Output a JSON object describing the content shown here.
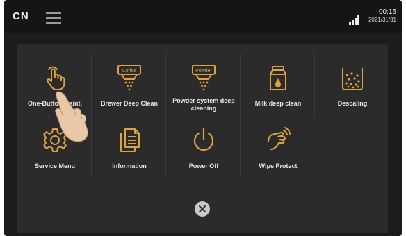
{
  "statusbar": {
    "lang": "CN",
    "time": "00:15",
    "date": "2021/31/31"
  },
  "tiles": [
    {
      "label": "One-Button Maint.",
      "icon": "hand-tap-icon"
    },
    {
      "label": "Brewer Deep Clean",
      "icon": "coffee-unit-icon",
      "icon_text": "Coffee"
    },
    {
      "label": "Powder system deep",
      "label2": "cleaning",
      "icon": "powder-unit-icon",
      "icon_text": "Powder"
    },
    {
      "label": "Milk deep clean",
      "icon": "milk-carton-icon"
    },
    {
      "label": "Descaling",
      "icon": "descaling-cup-icon"
    },
    {
      "label": "Service Menu",
      "icon": "gear-icon"
    },
    {
      "label": "Information",
      "icon": "documents-icon"
    },
    {
      "label": "Power Off",
      "icon": "power-icon"
    },
    {
      "label": "Wipe Protect",
      "icon": "wipe-hand-icon"
    }
  ],
  "colors": {
    "accent": "#d9a441",
    "background": "#1c1c1c",
    "panel": "#2b2b2b",
    "text": "#e8e8e8"
  }
}
